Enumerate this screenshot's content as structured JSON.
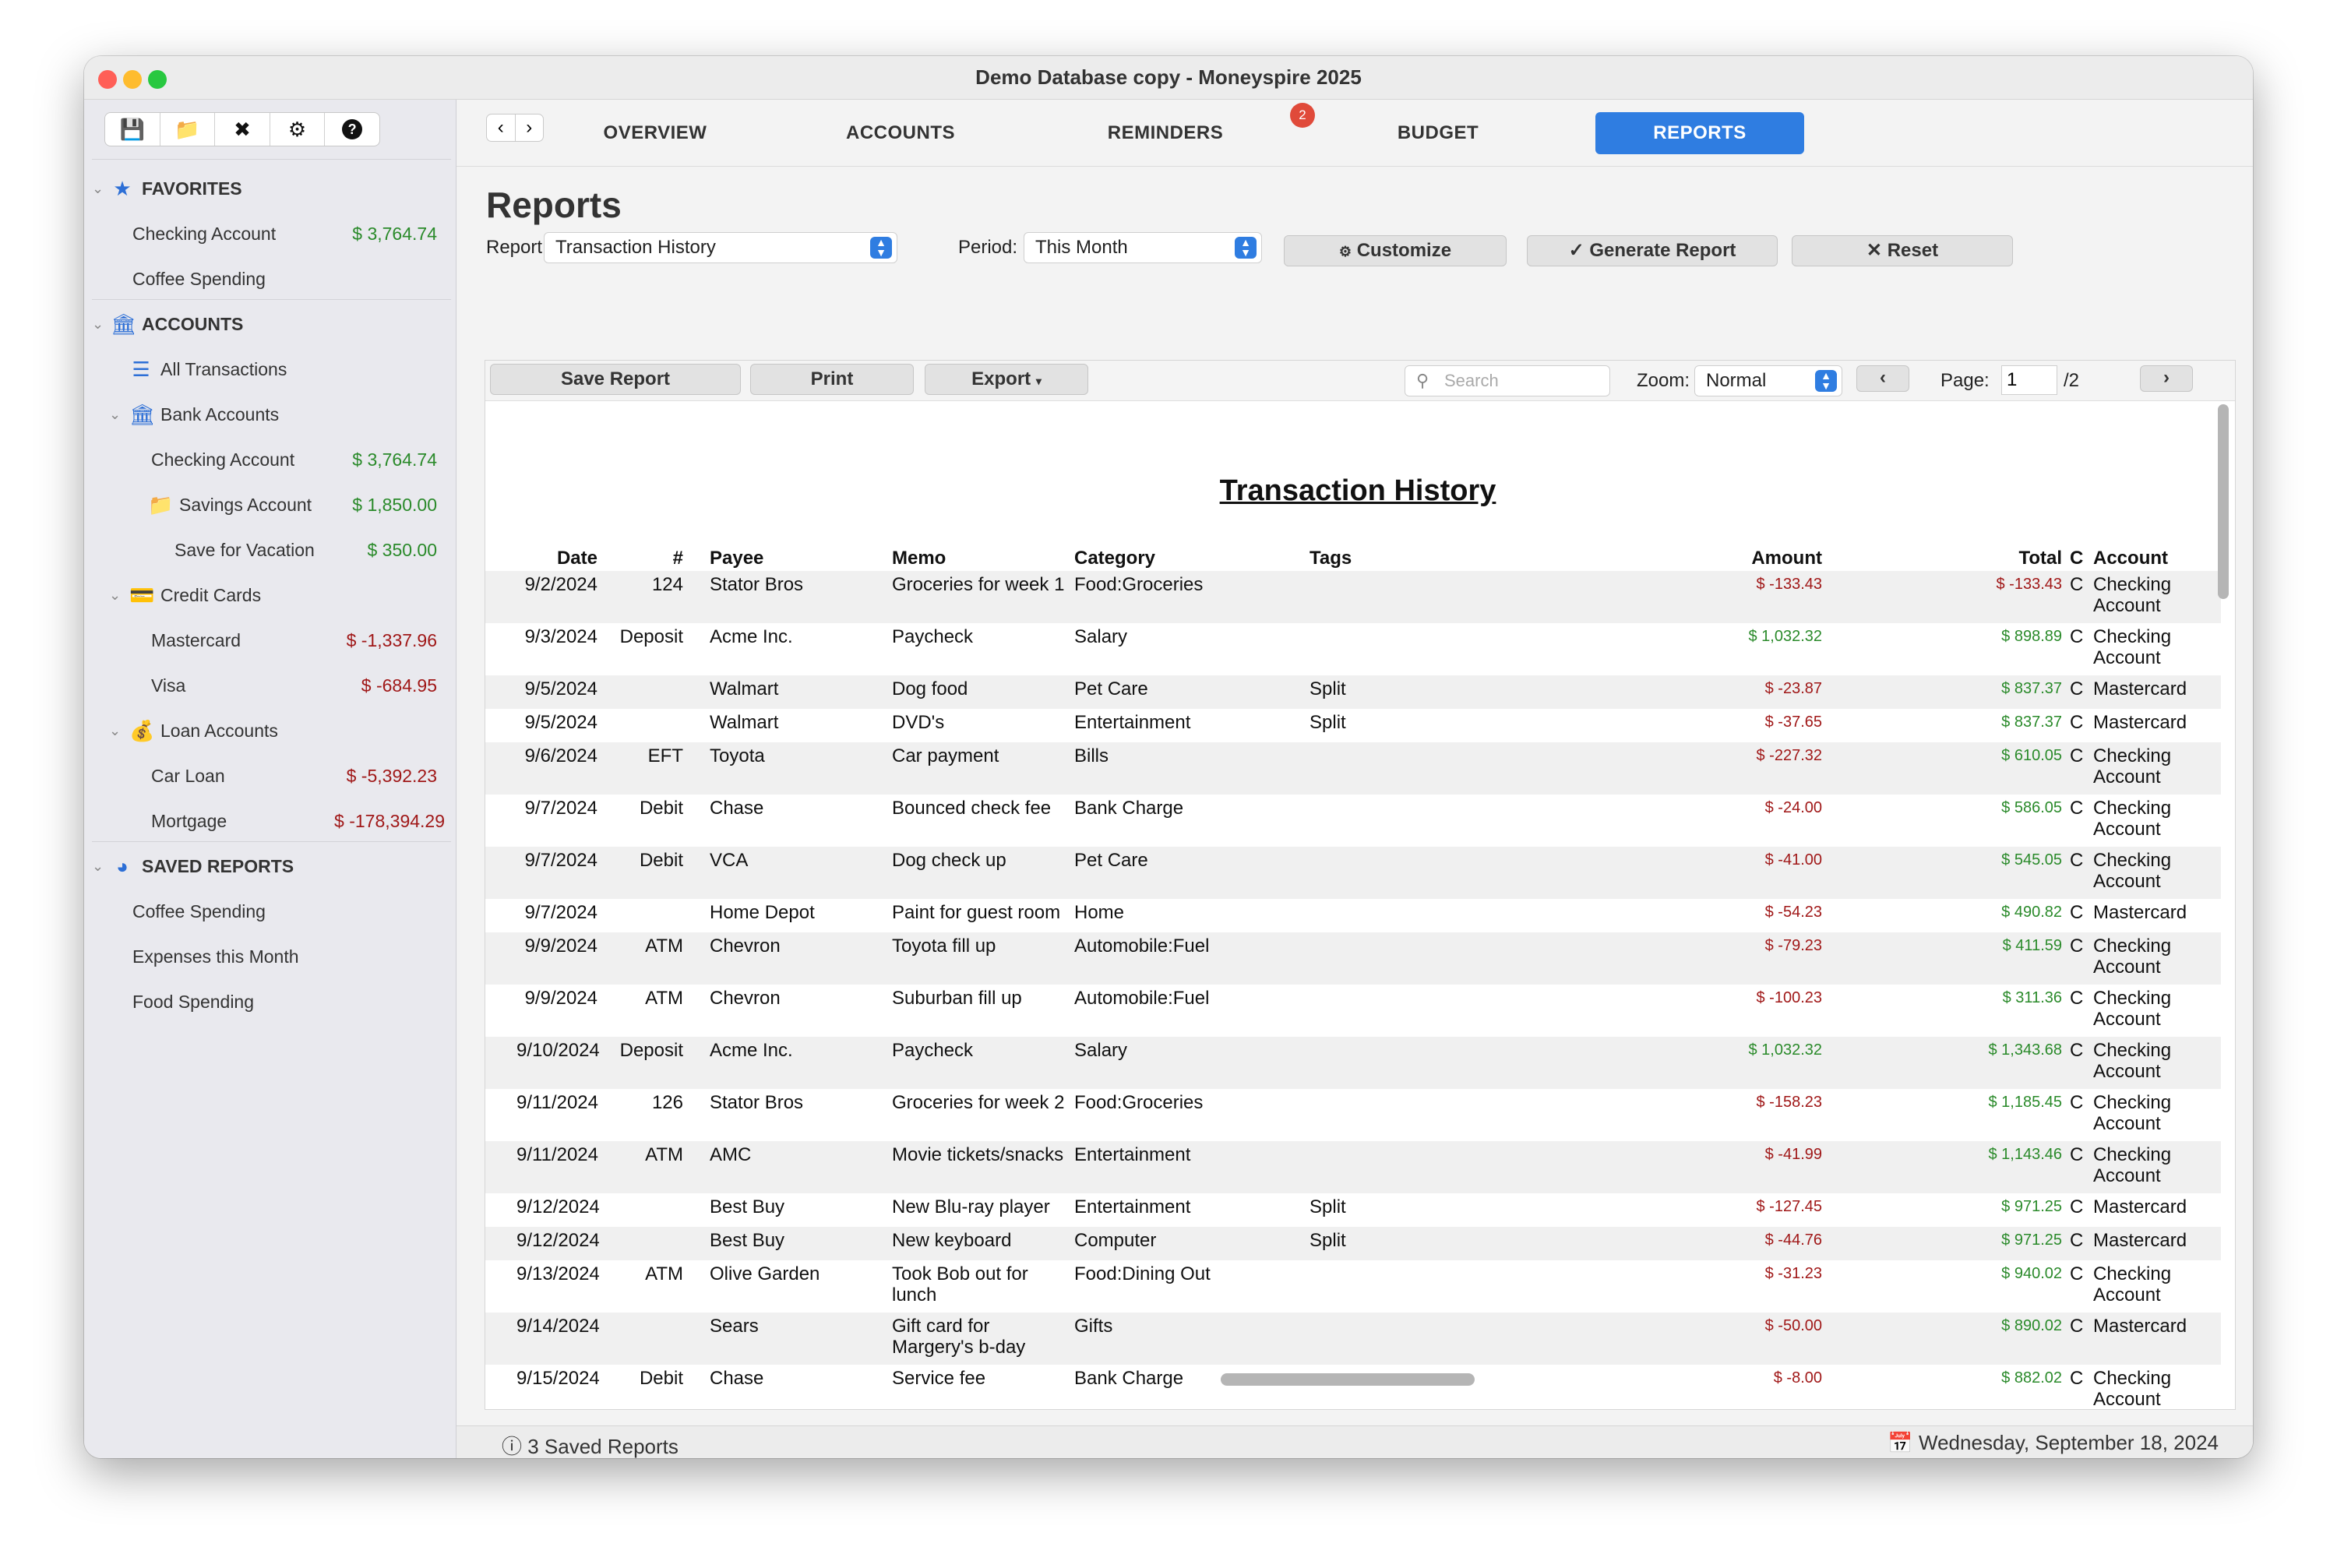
{
  "window": {
    "title": "Demo Database copy - Moneyspire 2025"
  },
  "sidebar": {
    "toolbar_icons": [
      "save-icon",
      "folder-icon",
      "tools-icon",
      "gear-icon",
      "help-icon"
    ],
    "favorites": {
      "header": "FAVORITES",
      "items": [
        {
          "label": "Checking Account",
          "amount": "$ 3,764.74"
        },
        {
          "label": "Coffee Spending",
          "amount": ""
        }
      ]
    },
    "accounts": {
      "header": "ACCOUNTS",
      "all_transactions": "All Transactions",
      "bank_accounts": "Bank Accounts",
      "checking": {
        "label": "Checking Account",
        "amount": "$ 3,764.74"
      },
      "savings": {
        "label": "Savings Account",
        "amount": "$ 1,850.00"
      },
      "vacation": {
        "label": "Save for Vacation",
        "amount": "$ 350.00"
      },
      "credit_cards": "Credit Cards",
      "mastercard": {
        "label": "Mastercard",
        "amount": "$ -1,337.96"
      },
      "visa": {
        "label": "Visa",
        "amount": "$ -684.95"
      },
      "loan_accounts": "Loan Accounts",
      "car_loan": {
        "label": "Car Loan",
        "amount": "$ -5,392.23"
      },
      "mortgage": {
        "label": "Mortgage",
        "amount": "$ -178,394.29"
      }
    },
    "saved_reports": {
      "header": "SAVED REPORTS",
      "items": [
        "Coffee Spending",
        "Expenses this Month",
        "Food Spending"
      ]
    }
  },
  "nav": {
    "tabs": [
      "OVERVIEW",
      "ACCOUNTS",
      "REMINDERS",
      "BUDGET",
      "REPORTS"
    ],
    "reminders_badge": "2",
    "back": "‹",
    "forward": "›"
  },
  "reports": {
    "heading": "Reports",
    "report_label": "Report:",
    "report_value": "Transaction History",
    "period_label": "Period:",
    "period_value": "This Month",
    "customize": "Customize",
    "generate": "Generate Report",
    "reset": "Reset"
  },
  "report_toolbar": {
    "save": "Save Report",
    "print": "Print",
    "export": "Export",
    "search_placeholder": "Search",
    "zoom_label": "Zoom:",
    "zoom_value": "Normal",
    "page_label": "Page:",
    "page_value": "1",
    "page_total": "/2"
  },
  "document": {
    "title": "Transaction History",
    "columns": [
      "Date",
      "#",
      "Payee",
      "Memo",
      "Category",
      "Tags",
      "Amount",
      "Total",
      "C",
      "Account"
    ],
    "rows": [
      {
        "date": "9/2/2024",
        "num": "124",
        "payee": "Stator Bros",
        "memo": "Groceries for week 1",
        "category": "Food:Groceries",
        "tags": "",
        "amount": "$ -133.43",
        "total": "$ -133.43",
        "c": "C",
        "account": "Checking Account"
      },
      {
        "date": "9/3/2024",
        "num": "Deposit",
        "payee": "Acme Inc.",
        "memo": "Paycheck",
        "category": "Salary",
        "tags": "",
        "amount": "$ 1,032.32",
        "total": "$ 898.89",
        "c": "C",
        "account": "Checking Account"
      },
      {
        "date": "9/5/2024",
        "num": "",
        "payee": "Walmart",
        "memo": "Dog food",
        "category": "Pet Care",
        "tags": "Split",
        "amount": "$ -23.87",
        "total": "$ 837.37",
        "c": "C",
        "account": "Mastercard"
      },
      {
        "date": "9/5/2024",
        "num": "",
        "payee": "Walmart",
        "memo": "DVD's",
        "category": "Entertainment",
        "tags": "Split",
        "amount": "$ -37.65",
        "total": "$ 837.37",
        "c": "C",
        "account": "Mastercard"
      },
      {
        "date": "9/6/2024",
        "num": "EFT",
        "payee": "Toyota",
        "memo": "Car payment",
        "category": "Bills",
        "tags": "",
        "amount": "$ -227.32",
        "total": "$ 610.05",
        "c": "C",
        "account": "Checking Account"
      },
      {
        "date": "9/7/2024",
        "num": "Debit",
        "payee": "Chase",
        "memo": "Bounced check fee",
        "category": "Bank Charge",
        "tags": "",
        "amount": "$ -24.00",
        "total": "$ 586.05",
        "c": "C",
        "account": "Checking Account"
      },
      {
        "date": "9/7/2024",
        "num": "Debit",
        "payee": "VCA",
        "memo": "Dog check up",
        "category": "Pet Care",
        "tags": "",
        "amount": "$ -41.00",
        "total": "$ 545.05",
        "c": "C",
        "account": "Checking Account"
      },
      {
        "date": "9/7/2024",
        "num": "",
        "payee": "Home Depot",
        "memo": "Paint for guest room",
        "category": "Home",
        "tags": "",
        "amount": "$ -54.23",
        "total": "$ 490.82",
        "c": "C",
        "account": "Mastercard"
      },
      {
        "date": "9/9/2024",
        "num": "ATM",
        "payee": "Chevron",
        "memo": "Toyota fill up",
        "category": "Automobile:Fuel",
        "tags": "",
        "amount": "$ -79.23",
        "total": "$ 411.59",
        "c": "C",
        "account": "Checking Account"
      },
      {
        "date": "9/9/2024",
        "num": "ATM",
        "payee": "Chevron",
        "memo": "Suburban fill up",
        "category": "Automobile:Fuel",
        "tags": "",
        "amount": "$ -100.23",
        "total": "$ 311.36",
        "c": "C",
        "account": "Checking Account"
      },
      {
        "date": "9/10/2024",
        "num": "Deposit",
        "payee": "Acme Inc.",
        "memo": "Paycheck",
        "category": "Salary",
        "tags": "",
        "amount": "$ 1,032.32",
        "total": "$ 1,343.68",
        "c": "C",
        "account": "Checking Account"
      },
      {
        "date": "9/11/2024",
        "num": "126",
        "payee": "Stator Bros",
        "memo": "Groceries for week 2",
        "category": "Food:Groceries",
        "tags": "",
        "amount": "$ -158.23",
        "total": "$ 1,185.45",
        "c": "C",
        "account": "Checking Account"
      },
      {
        "date": "9/11/2024",
        "num": "ATM",
        "payee": "AMC",
        "memo": "Movie tickets/snacks",
        "category": "Entertainment",
        "tags": "",
        "amount": "$ -41.99",
        "total": "$ 1,143.46",
        "c": "C",
        "account": "Checking Account"
      },
      {
        "date": "9/12/2024",
        "num": "",
        "payee": "Best Buy",
        "memo": "New Blu-ray player",
        "category": "Entertainment",
        "tags": "Split",
        "amount": "$ -127.45",
        "total": "$ 971.25",
        "c": "C",
        "account": "Mastercard"
      },
      {
        "date": "9/12/2024",
        "num": "",
        "payee": "Best Buy",
        "memo": "New keyboard",
        "category": "Computer",
        "tags": "Split",
        "amount": "$ -44.76",
        "total": "$ 971.25",
        "c": "C",
        "account": "Mastercard"
      },
      {
        "date": "9/13/2024",
        "num": "ATM",
        "payee": "Olive Garden",
        "memo": "Took Bob out for lunch",
        "category": "Food:Dining Out",
        "tags": "",
        "amount": "$ -31.23",
        "total": "$ 940.02",
        "c": "C",
        "account": "Checking Account"
      },
      {
        "date": "9/14/2024",
        "num": "",
        "payee": "Sears",
        "memo": "Gift card for Margery's b-day",
        "category": "Gifts",
        "tags": "",
        "amount": "$ -50.00",
        "total": "$ 890.02",
        "c": "C",
        "account": "Mastercard"
      },
      {
        "date": "9/15/2024",
        "num": "Debit",
        "payee": "Chase",
        "memo": "Service fee",
        "category": "Bank Charge",
        "tags": "",
        "amount": "$ -8.00",
        "total": "$ 882.02",
        "c": "C",
        "account": "Checking Account"
      }
    ]
  },
  "status": {
    "left": "ⓘ 3 Saved Reports",
    "right": "Wednesday, September 18, 2024"
  },
  "colors": {
    "accent": "#2f7de1",
    "positive": "#2a8a2a",
    "negative": "#a01818",
    "badge": "#e04a3a"
  }
}
